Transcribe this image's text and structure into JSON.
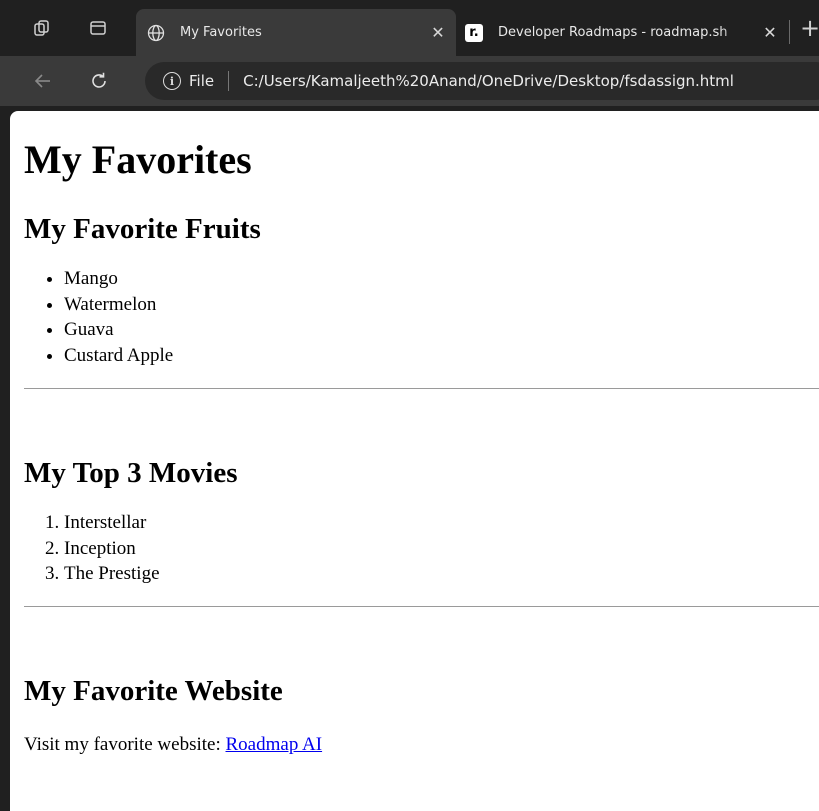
{
  "browser": {
    "tabs": [
      {
        "title": "My Favorites",
        "active": true
      },
      {
        "title": "Developer Roadmaps - roadmap.sh",
        "active": false
      }
    ],
    "info_label": "i",
    "address_scheme": "File",
    "address_url": "C:/Users/Kamaljeeth%20Anand/OneDrive/Desktop/fsdassign.html",
    "roadmap_logo_letter": "r."
  },
  "page": {
    "title": "My Favorites",
    "fruits": {
      "heading": "My Favorite Fruits",
      "items": [
        "Mango",
        "Watermelon",
        "Guava",
        "Custard Apple"
      ]
    },
    "movies": {
      "heading": "My Top 3 Movies",
      "items": [
        "Interstellar",
        "Inception",
        "The Prestige"
      ]
    },
    "website": {
      "heading": "My Favorite Website",
      "text": "Visit my favorite website: ",
      "link_label": "Roadmap AI"
    }
  },
  "colors": {
    "chrome_bg": "#202020",
    "toolbar_bg": "#3a3a3a",
    "link": "#0000ee"
  }
}
